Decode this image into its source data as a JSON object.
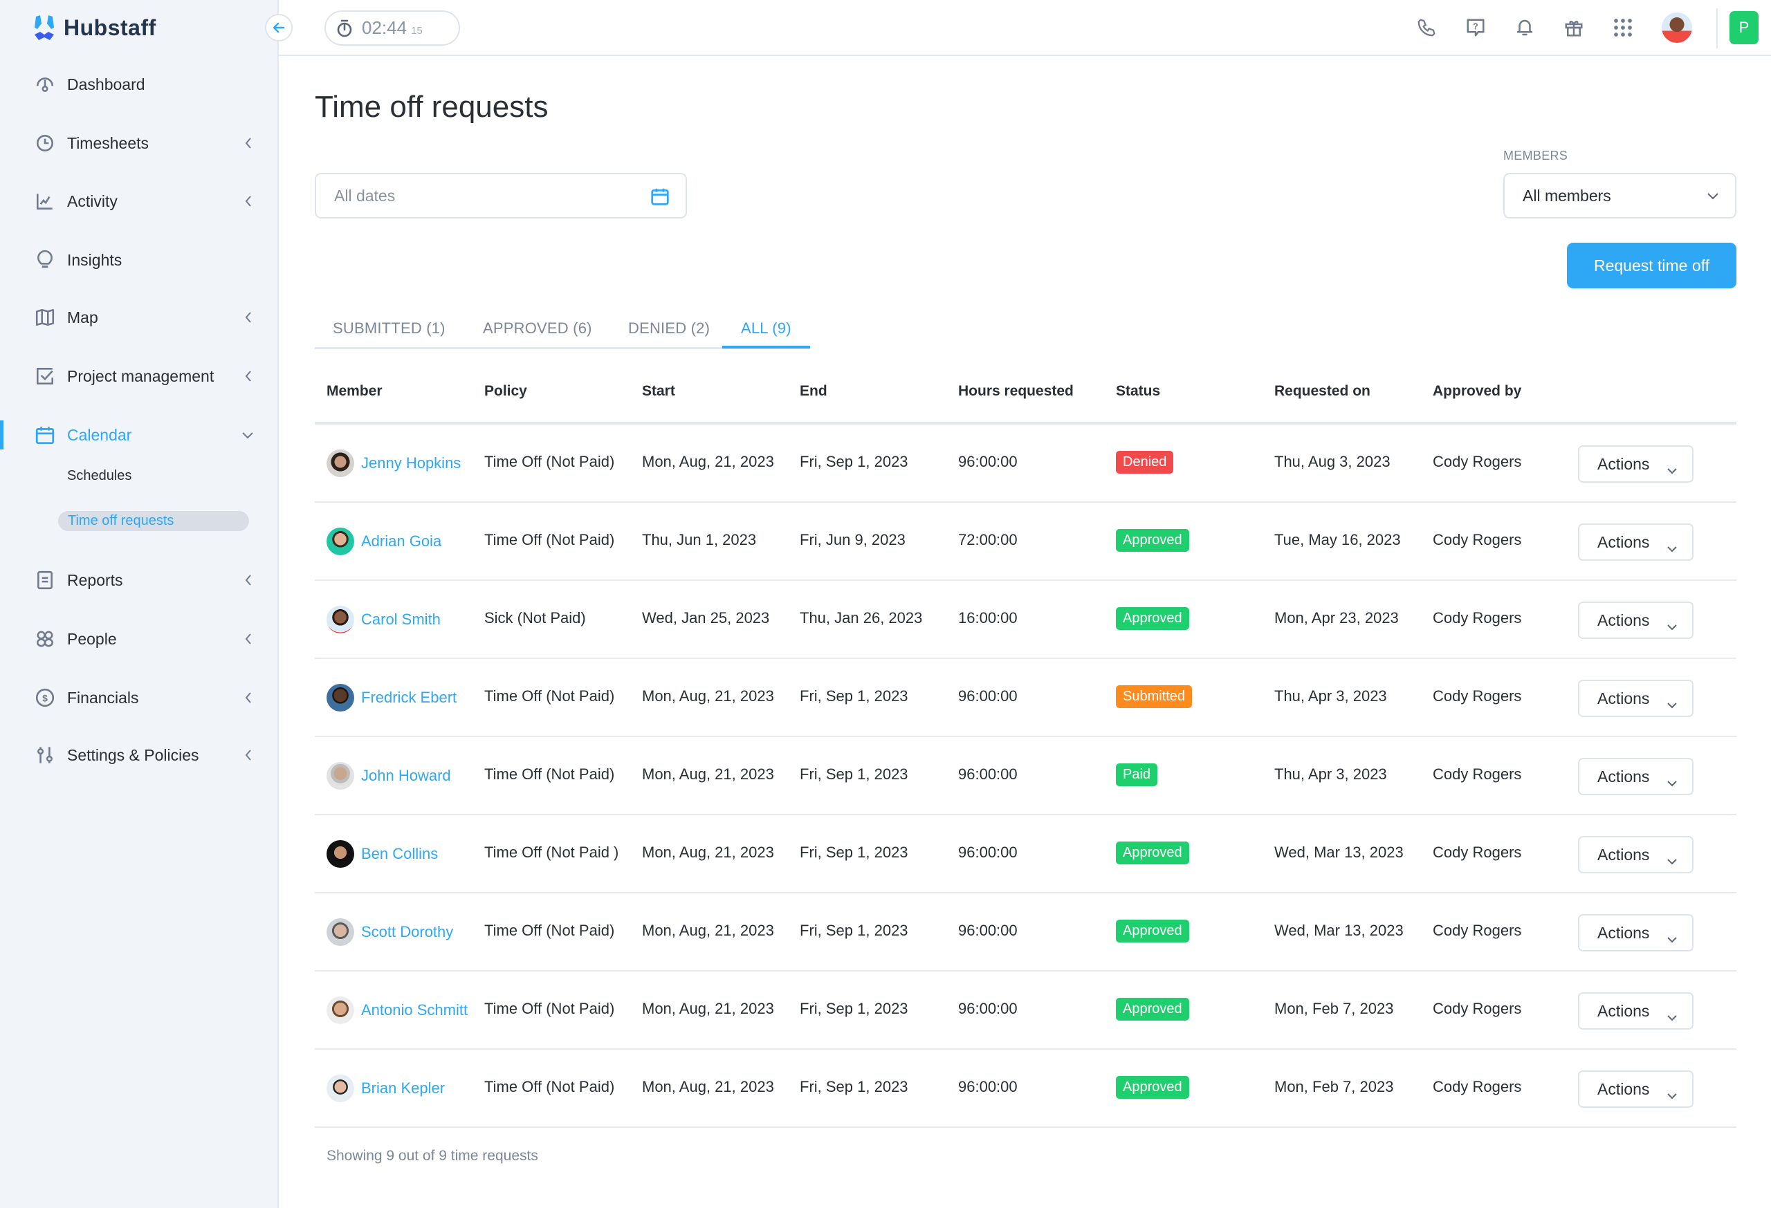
{
  "app": {
    "brand": "Hubstaff",
    "timer": {
      "main": "02:44",
      "seconds": "15"
    },
    "org_initial": "P",
    "colors": {
      "accent": "#2ea7f5",
      "approved": "#1fce6d",
      "denied": "#f2494a",
      "submitted": "#ff8a1e",
      "paid": "#1fce6d"
    }
  },
  "topbar": {
    "icons": [
      "phone-icon",
      "help-icon",
      "bell-icon",
      "gift-icon",
      "apps-grid-icon"
    ]
  },
  "sidebar": {
    "items": [
      {
        "label": "Dashboard",
        "icon": "dashboard-icon",
        "has_chevron": false
      },
      {
        "label": "Timesheets",
        "icon": "clock-icon",
        "has_chevron": true
      },
      {
        "label": "Activity",
        "icon": "activity-chart-icon",
        "has_chevron": true
      },
      {
        "label": "Insights",
        "icon": "lightbulb-icon",
        "has_chevron": false
      },
      {
        "label": "Map",
        "icon": "map-icon",
        "has_chevron": true
      },
      {
        "label": "Project management",
        "icon": "checkbox-icon",
        "has_chevron": true
      },
      {
        "label": "Calendar",
        "icon": "calendar-icon",
        "has_chevron": true,
        "active": true,
        "expanded": true
      },
      {
        "label": "Reports",
        "icon": "report-icon",
        "has_chevron": true
      },
      {
        "label": "People",
        "icon": "people-icon",
        "has_chevron": true
      },
      {
        "label": "Financials",
        "icon": "dollar-icon",
        "has_chevron": true
      },
      {
        "label": "Settings & Policies",
        "icon": "sliders-icon",
        "has_chevron": true
      }
    ],
    "calendar_sub": [
      {
        "label": "Schedules"
      },
      {
        "label": "Time off requests",
        "current": true
      }
    ]
  },
  "page": {
    "title": "Time off requests",
    "date_filter": {
      "placeholder": "All dates"
    },
    "members": {
      "label": "MEMBERS",
      "selected": "All members"
    },
    "request_button": "Request time off",
    "tabs": [
      {
        "label": "SUBMITTED (1)"
      },
      {
        "label": "APPROVED (6)"
      },
      {
        "label": "DENIED (2)"
      },
      {
        "label": "ALL (9)",
        "active": true
      }
    ]
  },
  "table": {
    "columns": [
      "Member",
      "Policy",
      "Start",
      "End",
      "Hours requested",
      "Status",
      "Requested on",
      "Approved by"
    ],
    "actions_label": "Actions",
    "rows": [
      {
        "member": "Jenny Hopkins",
        "policy": "Time Off (Not Paid)",
        "start": "Mon, Aug, 21, 2023",
        "end": "Fri, Sep 1, 2023",
        "hours": "96:00:00",
        "status": "Denied",
        "requested_on": "Thu, Aug 3, 2023",
        "approved_by": "Cody Rogers"
      },
      {
        "member": "Adrian Goia",
        "policy": "Time Off (Not Paid)",
        "start": "Thu, Jun 1, 2023",
        "end": "Fri, Jun 9, 2023",
        "hours": "72:00:00",
        "status": "Approved",
        "requested_on": "Tue, May 16, 2023",
        "approved_by": "Cody Rogers"
      },
      {
        "member": "Carol Smith",
        "policy": "Sick (Not Paid)",
        "start": "Wed, Jan 25, 2023",
        "end": "Thu, Jan 26, 2023",
        "hours": "16:00:00",
        "status": "Approved",
        "requested_on": "Mon, Apr 23, 2023",
        "approved_by": "Cody Rogers"
      },
      {
        "member": "Fredrick Ebert",
        "policy": "Time Off (Not Paid)",
        "start": "Mon, Aug, 21, 2023",
        "end": "Fri, Sep 1, 2023",
        "hours": "96:00:00",
        "status": "Submitted",
        "requested_on": "Thu, Apr 3, 2023",
        "approved_by": "Cody Rogers"
      },
      {
        "member": "John Howard",
        "policy": "Time Off (Not Paid)",
        "start": "Mon, Aug, 21, 2023",
        "end": "Fri, Sep 1, 2023",
        "hours": "96:00:00",
        "status": "Paid",
        "requested_on": "Thu, Apr 3, 2023",
        "approved_by": "Cody Rogers"
      },
      {
        "member": "Ben Collins",
        "policy": "Time Off (Not Paid )",
        "start": "Mon, Aug, 21, 2023",
        "end": "Fri, Sep 1, 2023",
        "hours": "96:00:00",
        "status": "Approved",
        "requested_on": "Wed, Mar 13, 2023",
        "approved_by": "Cody Rogers"
      },
      {
        "member": "Scott Dorothy",
        "policy": "Time Off (Not Paid)",
        "start": "Mon, Aug, 21, 2023",
        "end": "Fri, Sep 1, 2023",
        "hours": "96:00:00",
        "status": "Approved",
        "requested_on": "Wed, Mar 13, 2023",
        "approved_by": "Cody Rogers"
      },
      {
        "member": "Antonio Schmitt",
        "policy": "Time Off (Not Paid)",
        "start": "Mon, Aug, 21, 2023",
        "end": "Fri, Sep 1, 2023",
        "hours": "96:00:00",
        "status": "Approved",
        "requested_on": "Mon, Feb 7, 2023",
        "approved_by": "Cody Rogers"
      },
      {
        "member": "Brian Kepler",
        "policy": "Time Off (Not Paid)",
        "start": "Mon, Aug, 21, 2023",
        "end": "Fri, Sep 1, 2023",
        "hours": "96:00:00",
        "status": "Approved",
        "requested_on": "Mon, Feb 7, 2023",
        "approved_by": "Cody Rogers"
      }
    ],
    "footer": "Showing 9 out of 9 time requests"
  }
}
